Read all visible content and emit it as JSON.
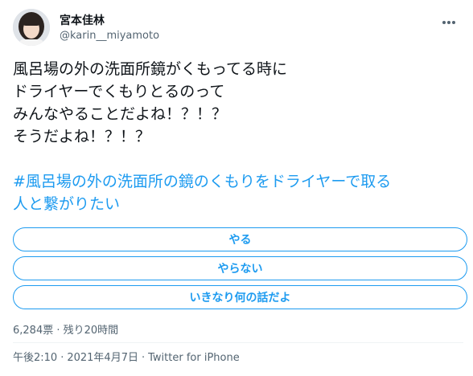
{
  "user": {
    "display_name": "宮本佳林",
    "handle": "@karin__miyamoto"
  },
  "tweet": {
    "lines": [
      "風呂場の外の洗面所鏡がくもってる時に",
      "ドライヤーでくもりとるのって",
      "みんなやることだよね！？！？",
      "そうだよね！？！？"
    ],
    "hashtag_lines": [
      "#風呂場の外の洗面所の鏡のくもりをドライヤーで取る",
      "人と繋がりたい"
    ]
  },
  "poll": {
    "options": [
      "やる",
      "やらない",
      "いきなり何の話だよ"
    ],
    "votes": "6,284票",
    "separator": "·",
    "remaining": "残り20時間"
  },
  "meta": {
    "time": "午後2:10",
    "date": "2021年4月7日",
    "source": "Twitter for iPhone",
    "separator": "·"
  },
  "colors": {
    "accent": "#1d9bf0",
    "text": "#0f1419",
    "muted": "#536471"
  },
  "icons": {
    "avatar": "avatar-image",
    "more": "more-dots-icon"
  }
}
